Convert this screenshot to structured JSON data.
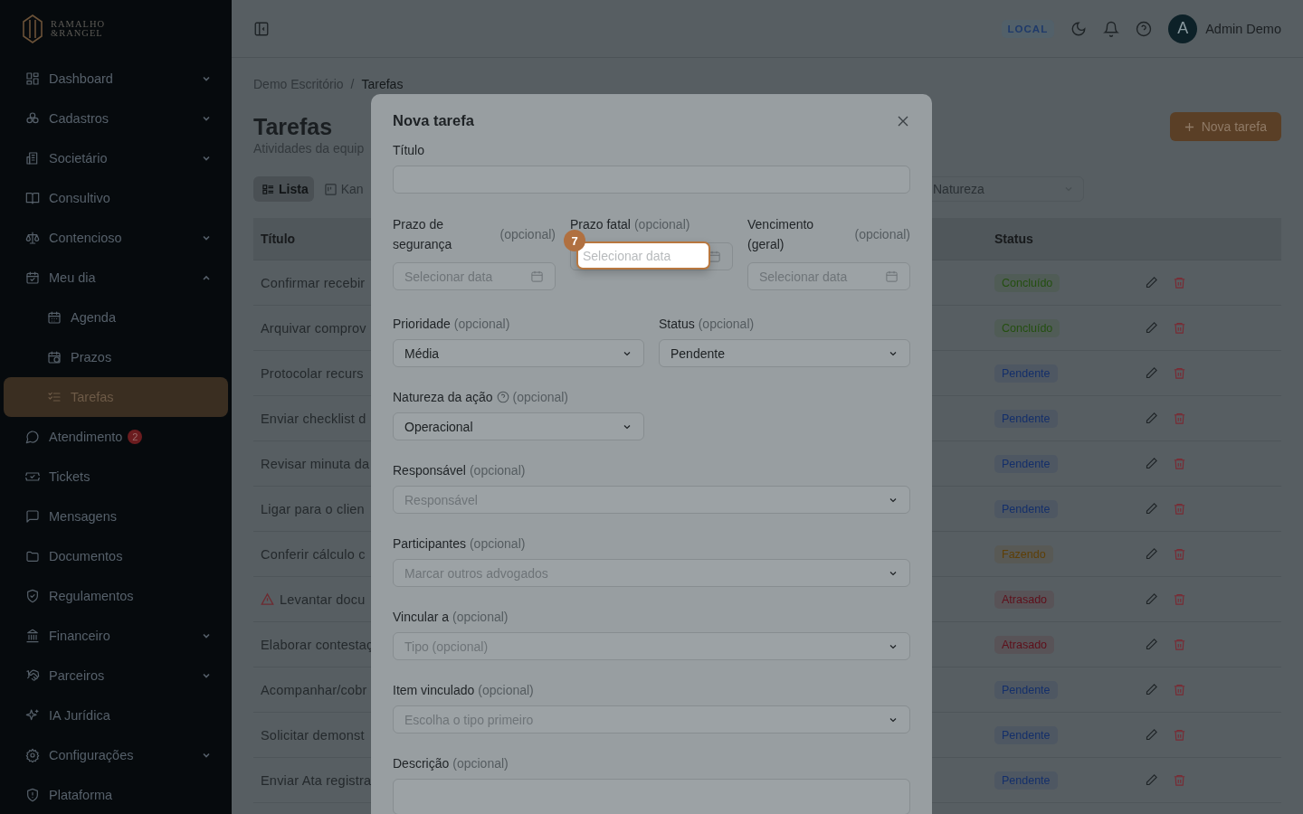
{
  "logo": {
    "lines": [
      "RAMALHO",
      "&RANGEL"
    ]
  },
  "sidebar": {
    "items": [
      {
        "label": "Dashboard",
        "kind": "group",
        "expanded": false,
        "selected": false
      },
      {
        "label": "Cadastros",
        "kind": "group",
        "expanded": false,
        "selected": false
      },
      {
        "label": "Societário",
        "kind": "group",
        "expanded": false,
        "selected": false
      },
      {
        "label": "Consultivo",
        "kind": "link",
        "selected": false
      },
      {
        "label": "Contencioso",
        "kind": "group",
        "expanded": false,
        "selected": false
      },
      {
        "label": "Meu dia",
        "kind": "group",
        "expanded": true,
        "selected": false,
        "children": [
          {
            "label": "Agenda",
            "selected": false
          },
          {
            "label": "Prazos",
            "selected": false
          },
          {
            "label": "Tarefas",
            "selected": true
          }
        ]
      },
      {
        "label": "Atendimento",
        "kind": "link",
        "selected": false,
        "badge": "2"
      },
      {
        "label": "Tickets",
        "kind": "link",
        "selected": false
      },
      {
        "label": "Mensagens",
        "kind": "link",
        "selected": false
      },
      {
        "label": "Documentos",
        "kind": "link",
        "selected": false
      },
      {
        "label": "Regulamentos",
        "kind": "link",
        "selected": false
      },
      {
        "label": "Financeiro",
        "kind": "group",
        "expanded": false,
        "selected": false
      },
      {
        "label": "Parceiros",
        "kind": "group",
        "expanded": false,
        "selected": false
      },
      {
        "label": "IA Jurídica",
        "kind": "link",
        "selected": false
      },
      {
        "label": "Configurações",
        "kind": "group",
        "expanded": false,
        "selected": false
      },
      {
        "label": "Plataforma",
        "kind": "link",
        "selected": false
      }
    ]
  },
  "header": {
    "environment": "LOCAL",
    "avatar": "A",
    "user": "Admin Demo"
  },
  "breadcrumbs": [
    "Demo Escritório",
    "Tarefas"
  ],
  "breadcrumb_separator": "/",
  "page": {
    "title": "Tarefas",
    "subtitle": "Atividades da equip",
    "new_button": "Nova tarefa"
  },
  "views": [
    {
      "label": "Lista",
      "selected": true
    },
    {
      "label": "Kan",
      "selected": false
    }
  ],
  "filter": {
    "placeholder": "Natureza"
  },
  "table": {
    "columns": [
      "Título",
      "Status"
    ],
    "rows": [
      {
        "title": "Confirmar recebir",
        "warning": false,
        "status": "Concluído",
        "color": "#244f10"
      },
      {
        "title": "Arquivar comprov",
        "warning": false,
        "status": "Concluído",
        "color": "#244f10"
      },
      {
        "title": "Protocolar recurs",
        "warning": false,
        "status": "Pendente",
        "color": "#142f6a"
      },
      {
        "title": "Enviar checklist d",
        "warning": false,
        "status": "Pendente",
        "color": "#142f6a"
      },
      {
        "title": "Revisar minuta da",
        "warning": false,
        "status": "Pendente",
        "color": "#142f6a"
      },
      {
        "title": "Ligar para o clien",
        "warning": false,
        "status": "Pendente",
        "color": "#142f6a"
      },
      {
        "title": "Conferir cálculo c",
        "warning": false,
        "status": "Fazendo",
        "color": "#5e3f06"
      },
      {
        "title": "Levantar docu",
        "warning": true,
        "status": "Atrasado",
        "color": "#5e0f1a"
      },
      {
        "title": "Elaborar contestaç",
        "warning": false,
        "status": "Atrasado",
        "color": "#5e0f1a"
      },
      {
        "title": "Acompanhar/cobr",
        "warning": false,
        "status": "Pendente",
        "color": "#142f6a"
      },
      {
        "title": "Solicitar demonst",
        "warning": false,
        "status": "Pendente",
        "color": "#142f6a"
      },
      {
        "title": "Enviar Ata registra",
        "warning": false,
        "status": "Pendente",
        "color": "#142f6a"
      }
    ]
  },
  "modal": {
    "title": "Nova tarefa",
    "title_field": {
      "label": "Título"
    },
    "dates": [
      {
        "label": "Prazo de segurança",
        "optional": "(opcional)",
        "placeholder": "Selecionar data",
        "highlighted": false
      },
      {
        "label": "Prazo fatal",
        "optional": "(opcional)",
        "placeholder": "Selecionar data",
        "highlighted": true
      },
      {
        "label": "Vencimento (geral)",
        "optional": "(opcional)",
        "placeholder": "Selecionar data",
        "highlighted": false
      }
    ],
    "selects": [
      {
        "label": "Prioridade",
        "optional": "(opcional)",
        "value": "Média"
      },
      {
        "label": "Status",
        "optional": "(opcional)",
        "value": "Pendente"
      }
    ],
    "fields": [
      {
        "label": "Natureza da ação",
        "optional": "(opcional)",
        "value": "Operacional",
        "help": true
      },
      {
        "label": "Responsável",
        "optional": "(opcional)",
        "placeholder": "Responsável",
        "help": false
      },
      {
        "label": "Participantes",
        "optional": "(opcional)",
        "placeholder": "Marcar outros advogados",
        "help": false
      },
      {
        "label": "Vincular a",
        "optional": "(opcional)",
        "placeholder": "Tipo (opcional)",
        "help": false
      },
      {
        "label": "Item vinculado",
        "optional": "(opcional)",
        "placeholder": "Escolha o tipo primeiro",
        "help": false
      }
    ],
    "description": {
      "label": "Descrição",
      "optional": "(opcional)"
    }
  },
  "tour": {
    "step": "7"
  }
}
